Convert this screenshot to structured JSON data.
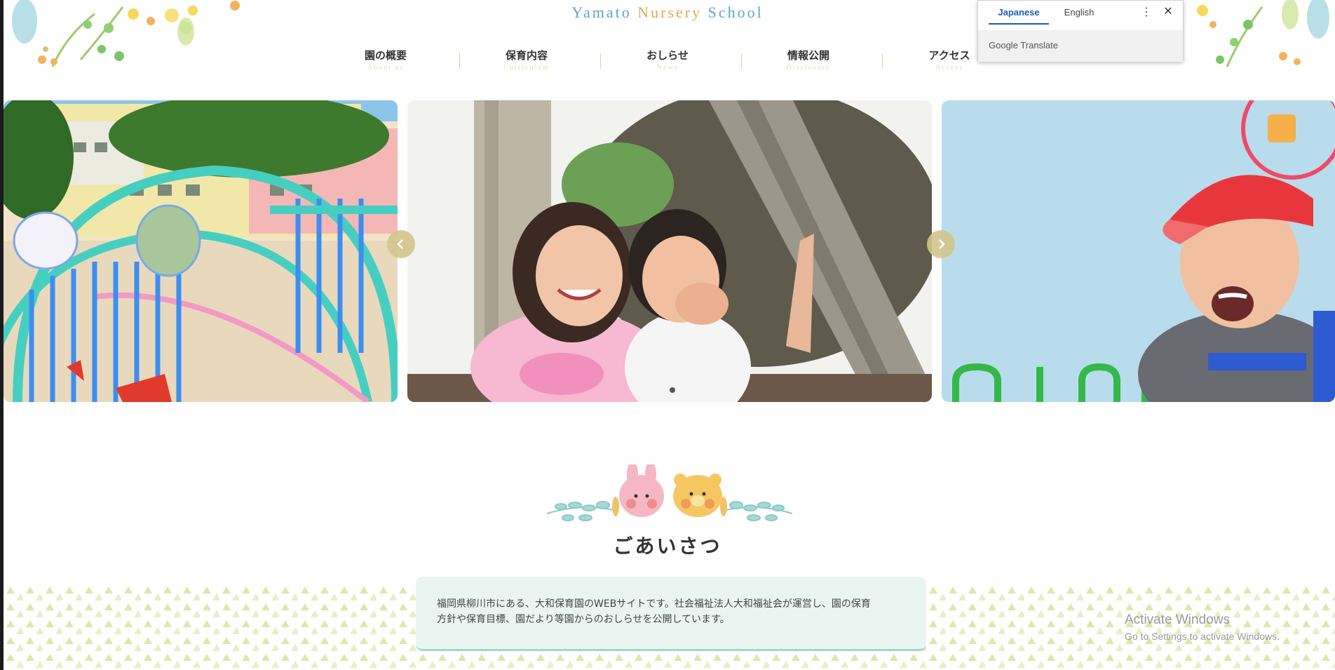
{
  "header": {
    "title_part1": "Yamato ",
    "title_part2": "Nursery ",
    "title_part3": "School"
  },
  "nav": {
    "items": [
      {
        "jp": "園の概要",
        "en": "About us"
      },
      {
        "jp": "保育内容",
        "en": "Curriculum"
      },
      {
        "jp": "おしらせ",
        "en": "News"
      },
      {
        "jp": "情報公開",
        "en": "Disclosure"
      },
      {
        "jp": "アクセス",
        "en": "Access"
      }
    ]
  },
  "slider": {
    "slides": [
      "playground-equipment",
      "two-children-laughing",
      "boy-red-cap"
    ],
    "active_dot": 1,
    "dot_count": 2
  },
  "greeting": {
    "title": "ごあいさつ",
    "text_line1": "福岡県柳川市にある、大和保育園のWEBサイトです。社会福祉法人大和福祉会が運営し、園の保育",
    "text_line2": "方針や保育目標、園だより等園からのおしらせを公開しています。"
  },
  "translate_popup": {
    "tab_japanese": "Japanese",
    "tab_english": "English",
    "active_tab": "Japanese",
    "footer_google": "Google",
    "footer_translate": " Translate"
  },
  "watermark": {
    "line1": "Activate Windows",
    "line2": "Go to Settings to activate Windows."
  },
  "colors": {
    "title_blue": "#5aa6c9",
    "title_orange": "#e1a94a",
    "nav_sub": "#e8dcb0",
    "greeting_box": "#eaf5f2",
    "accent_blue": "#1a5fb4"
  }
}
